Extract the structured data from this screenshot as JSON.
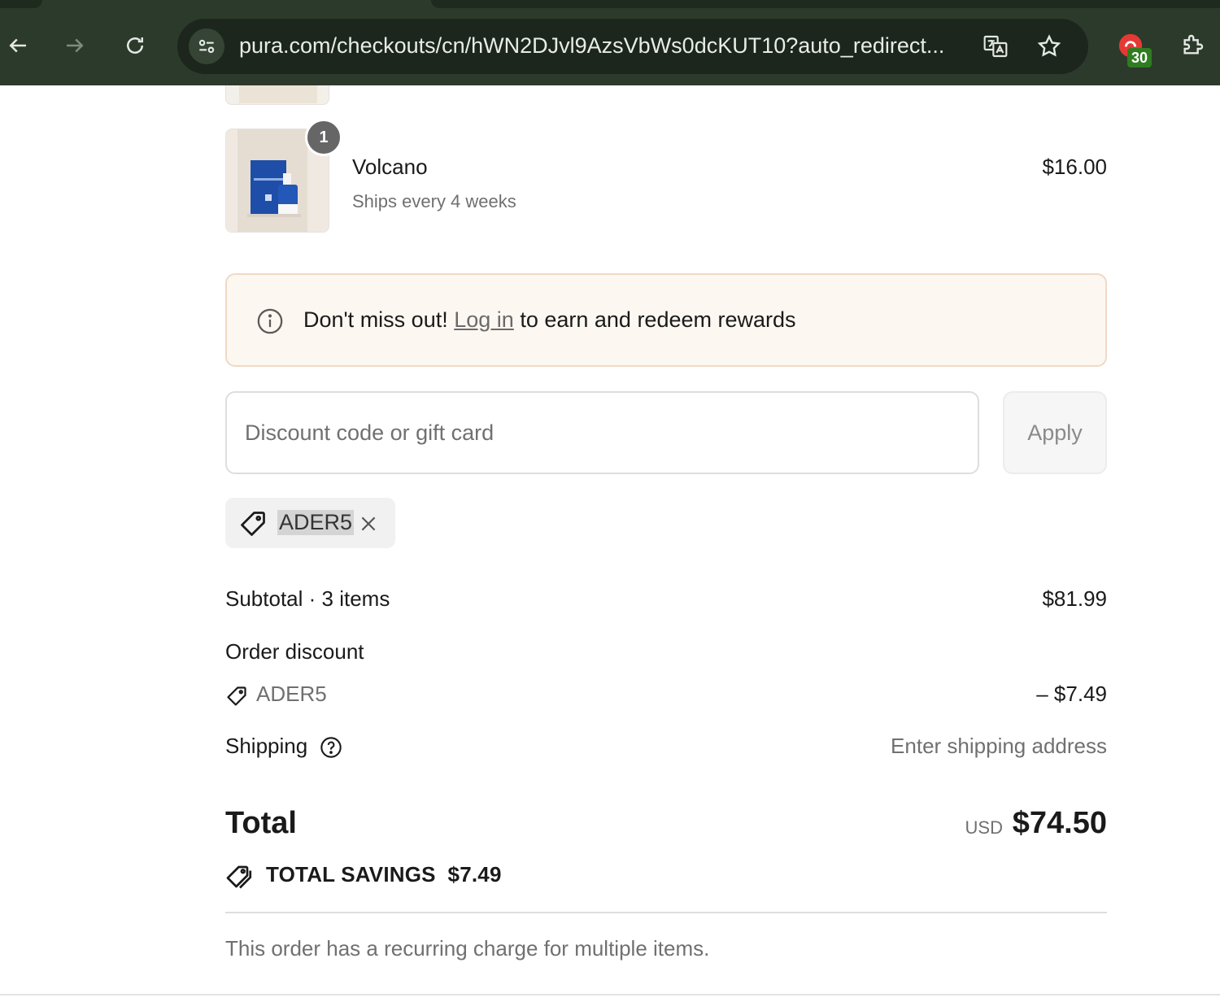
{
  "browser": {
    "url": "pura.com/checkouts/cn/hWN2DJvl9AzsVbWs0dcKUT10?auto_redirect...",
    "extension_badge": "30",
    "icons": [
      "back-arrow-icon",
      "forward-arrow-icon",
      "reload-icon",
      "site-settings-icon",
      "translate-icon",
      "bookmark-star-icon",
      "extension-icon",
      "puzzle-extensions-icon"
    ]
  },
  "line_item": {
    "quantity": "1",
    "name": "Volcano",
    "subtitle": "Ships every 4 weeks",
    "price": "$16.00"
  },
  "rewards_banner": {
    "prefix": "Don't miss out!",
    "link": "Log in",
    "suffix": "to earn and redeem rewards"
  },
  "discount": {
    "placeholder": "Discount code or gift card",
    "apply_label": "Apply",
    "applied_code": "ADER5"
  },
  "summary": {
    "subtotal_label": "Subtotal · 3 items",
    "subtotal_value": "$81.99",
    "order_discount_label": "Order discount",
    "discount_code": "ADER5",
    "discount_value": "– $7.49",
    "shipping_label": "Shipping",
    "shipping_value": "Enter shipping address",
    "total_label": "Total",
    "currency": "USD",
    "total_value": "$74.50",
    "savings_text": "TOTAL SAVINGS  $7.49",
    "recurring_note": "This order has a recurring charge for multiple items."
  },
  "colors": {
    "chrome_bg": "#2c3a2b",
    "banner_bg": "#fdf7f1",
    "banner_border": "#f0d9c5",
    "muted_text": "#707070"
  }
}
